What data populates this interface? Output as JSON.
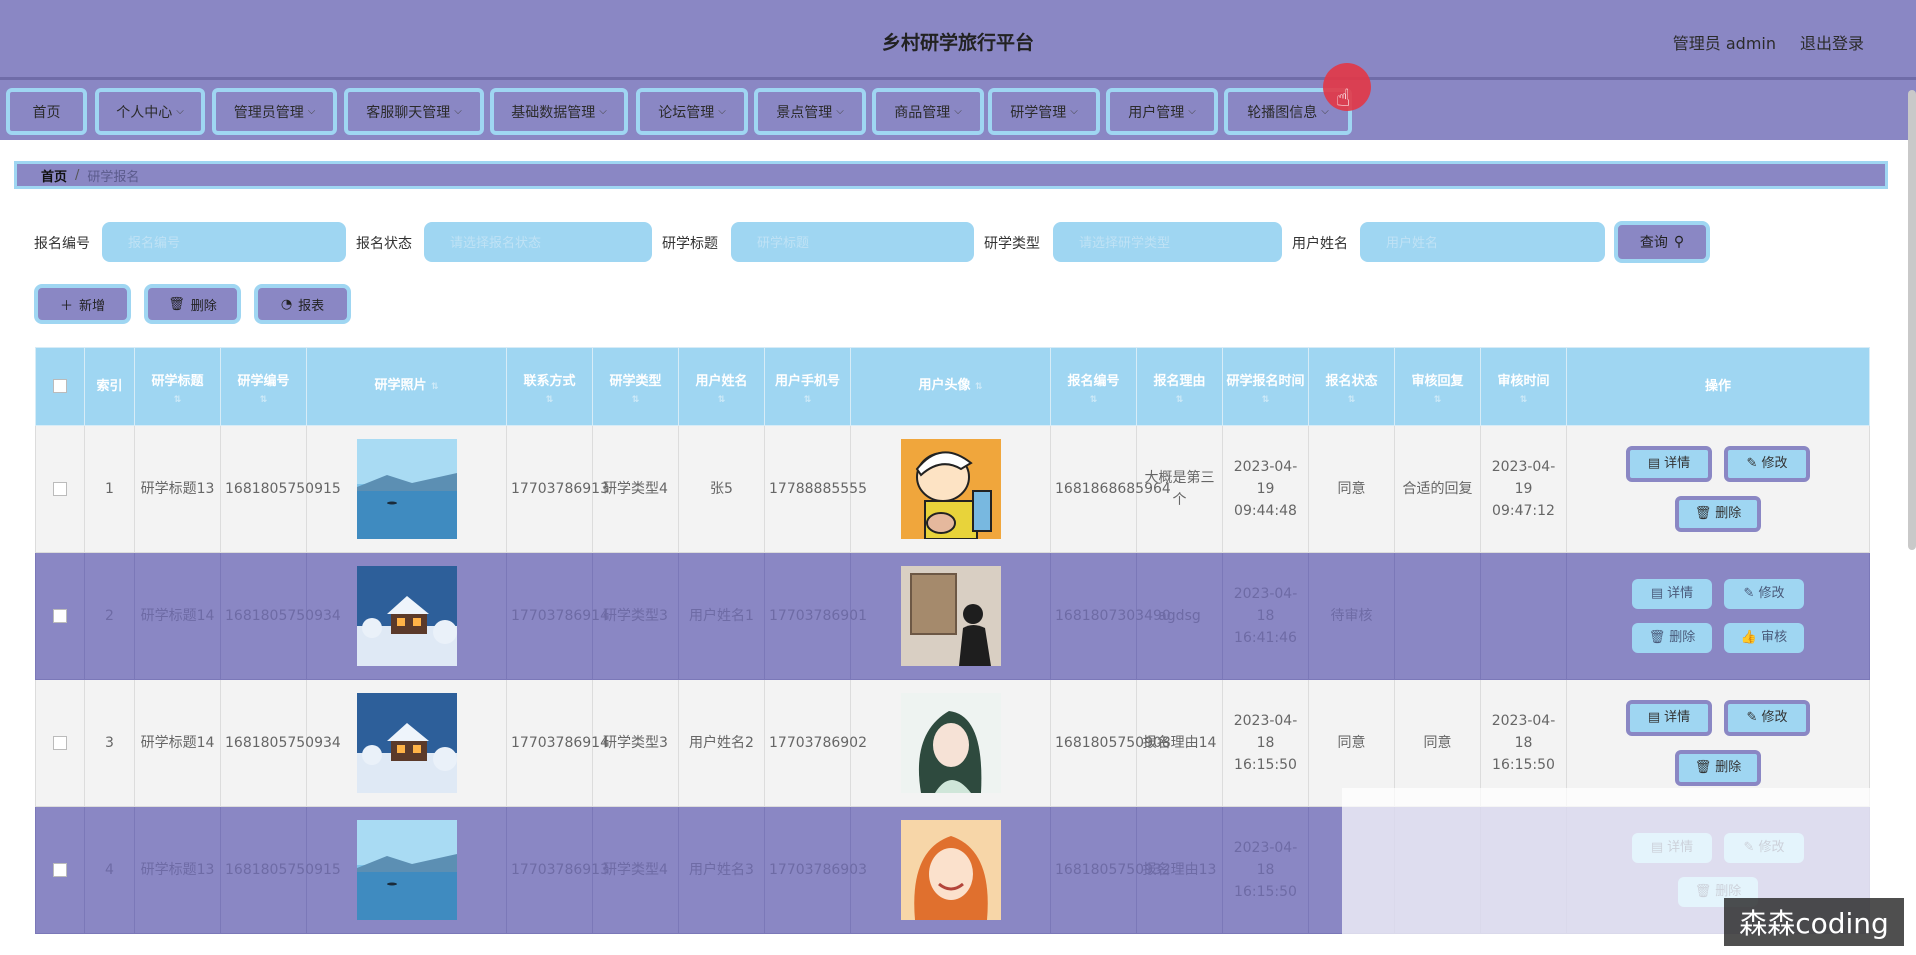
{
  "header": {
    "title": "乡村研学旅行平台",
    "user": "管理员 admin",
    "logout": "退出登录"
  },
  "nav": [
    {
      "label": "首页",
      "dropdown": false
    },
    {
      "label": "个人中心",
      "dropdown": true
    },
    {
      "label": "管理员管理",
      "dropdown": true
    },
    {
      "label": "客服聊天管理",
      "dropdown": true
    },
    {
      "label": "基础数据管理",
      "dropdown": true
    },
    {
      "label": "论坛管理",
      "dropdown": true
    },
    {
      "label": "景点管理",
      "dropdown": true
    },
    {
      "label": "商品管理",
      "dropdown": true
    },
    {
      "label": "研学管理",
      "dropdown": true
    },
    {
      "label": "用户管理",
      "dropdown": true
    },
    {
      "label": "轮播图信息",
      "dropdown": true
    }
  ],
  "breadcrumb": {
    "home": "首页",
    "sep": "/",
    "current": "研学报名"
  },
  "search": {
    "fields": [
      {
        "label": "报名编号",
        "placeholder": "报名编号"
      },
      {
        "label": "报名状态",
        "placeholder": "请选择报名状态"
      },
      {
        "label": "研学标题",
        "placeholder": "研学标题"
      },
      {
        "label": "研学类型",
        "placeholder": "请选择研学类型"
      },
      {
        "label": "用户姓名",
        "placeholder": "用户姓名"
      }
    ],
    "button": "查询"
  },
  "actions": {
    "add": "新增",
    "delete": "删除",
    "report": "报表"
  },
  "table": {
    "headers": [
      "索引",
      "研学标题",
      "研学编号",
      "研学照片",
      "联系方式",
      "研学类型",
      "用户姓名",
      "用户手机号",
      "用户头像",
      "报名编号",
      "报名理由",
      "研学报名时间",
      "报名状态",
      "审核回复",
      "审核时间",
      "操作"
    ],
    "rows": [
      {
        "index": "1",
        "title": "研学标题13",
        "code": "1681805750915",
        "contact": "17703786913",
        "type": "研学类型4",
        "user": "张5",
        "phone": "17788885555",
        "reg_no": "1681868685964",
        "reason": "大概是第三个",
        "reg_time": "2023-04-19 09:44:48",
        "status": "同意",
        "reply": "合适的回复",
        "audit_time": "2023-04-19 09:47:12",
        "ops": [
          "详情",
          "修改",
          "删除"
        ]
      },
      {
        "index": "2",
        "title": "研学标题14",
        "code": "1681805750934",
        "contact": "17703786914",
        "type": "研学类型3",
        "user": "用户姓名1",
        "phone": "17703786901",
        "reg_no": "1681807303490",
        "reason": "agdsg",
        "reg_time": "2023-04-18 16:41:46",
        "status": "待审核",
        "reply": "",
        "audit_time": "",
        "ops": [
          "详情",
          "修改",
          "删除",
          "审核"
        ]
      },
      {
        "index": "3",
        "title": "研学标题14",
        "code": "1681805750934",
        "contact": "17703786914",
        "type": "研学类型3",
        "user": "用户姓名2",
        "phone": "17703786902",
        "reg_no": "1681805750908",
        "reason": "报名理由14",
        "reg_time": "2023-04-18 16:15:50",
        "status": "同意",
        "reply": "同意",
        "audit_time": "2023-04-18 16:15:50",
        "ops": [
          "详情",
          "修改",
          "删除"
        ]
      },
      {
        "index": "4",
        "title": "研学标题13",
        "code": "1681805750915",
        "contact": "17703786913",
        "type": "研学类型4",
        "user": "用户姓名3",
        "phone": "17703786903",
        "reg_no": "1681805750932",
        "reason": "报名理由13",
        "reg_time": "2023-04-18 16:15:50",
        "status": "",
        "reply": "",
        "audit_time": "",
        "ops": [
          "详情",
          "修改",
          "删除"
        ]
      }
    ]
  },
  "watermark": "森森coding"
}
